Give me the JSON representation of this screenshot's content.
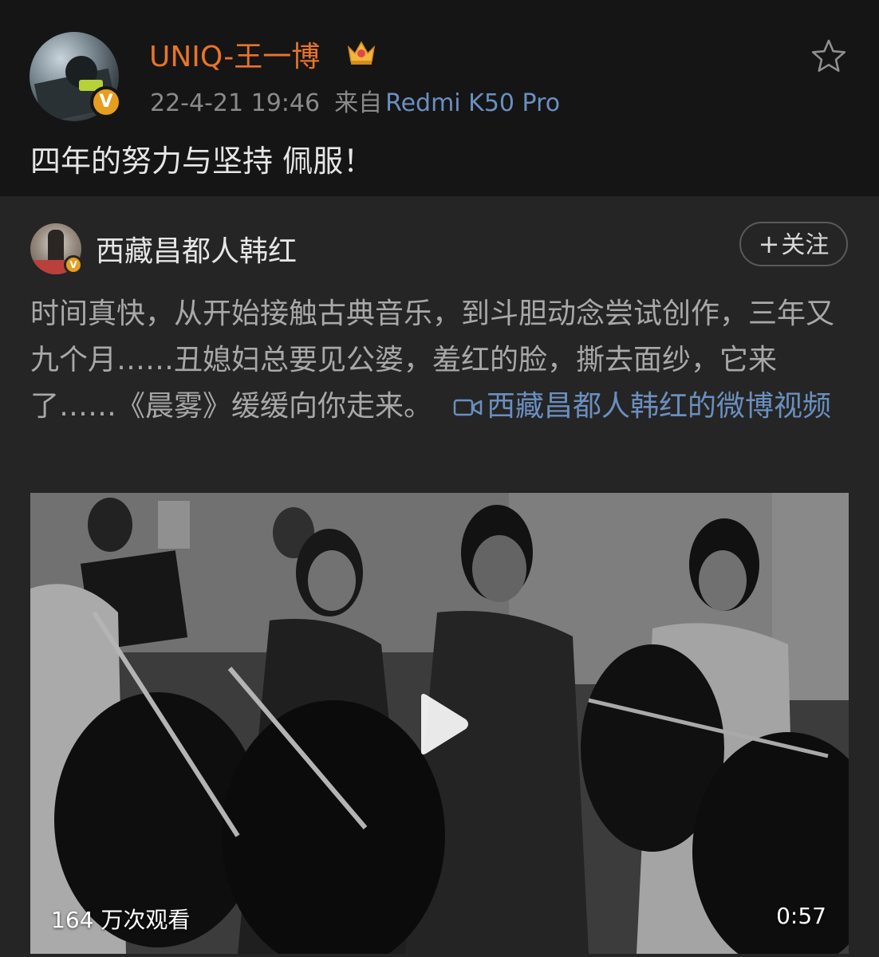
{
  "post": {
    "username": "UNIQ-王一博",
    "timestamp": "22-4-21 19:46",
    "source_label": "来自",
    "device": "Redmi K50 Pro",
    "text": "四年的努力与坚持 佩服！",
    "verified_badge": "V",
    "icons": [
      "crown-badge-icon",
      "star-icon",
      "verified-icon"
    ]
  },
  "repost": {
    "author": "西藏昌都人韩红",
    "follow_label": "关注",
    "follow_plus": "+",
    "text": "时间真快，从开始接触古典音乐，到斗胆动念尝试创作，三年又九个月……丑媳妇总要见公婆，羞红的脸，撕去面纱，它来了……《晨雾》缓缓向你走来。",
    "link_text": "西藏昌都人韩红的微博视频",
    "verified_badge": "V",
    "video": {
      "views": "164 万次观看",
      "duration": "0:57",
      "icons": [
        "play-icon",
        "video-camera-icon"
      ]
    }
  },
  "colors": {
    "username": "#e8742b",
    "link": "#6a8fbf",
    "background": "#151515",
    "repost_background": "#252525",
    "verified": "#e59e1f"
  }
}
